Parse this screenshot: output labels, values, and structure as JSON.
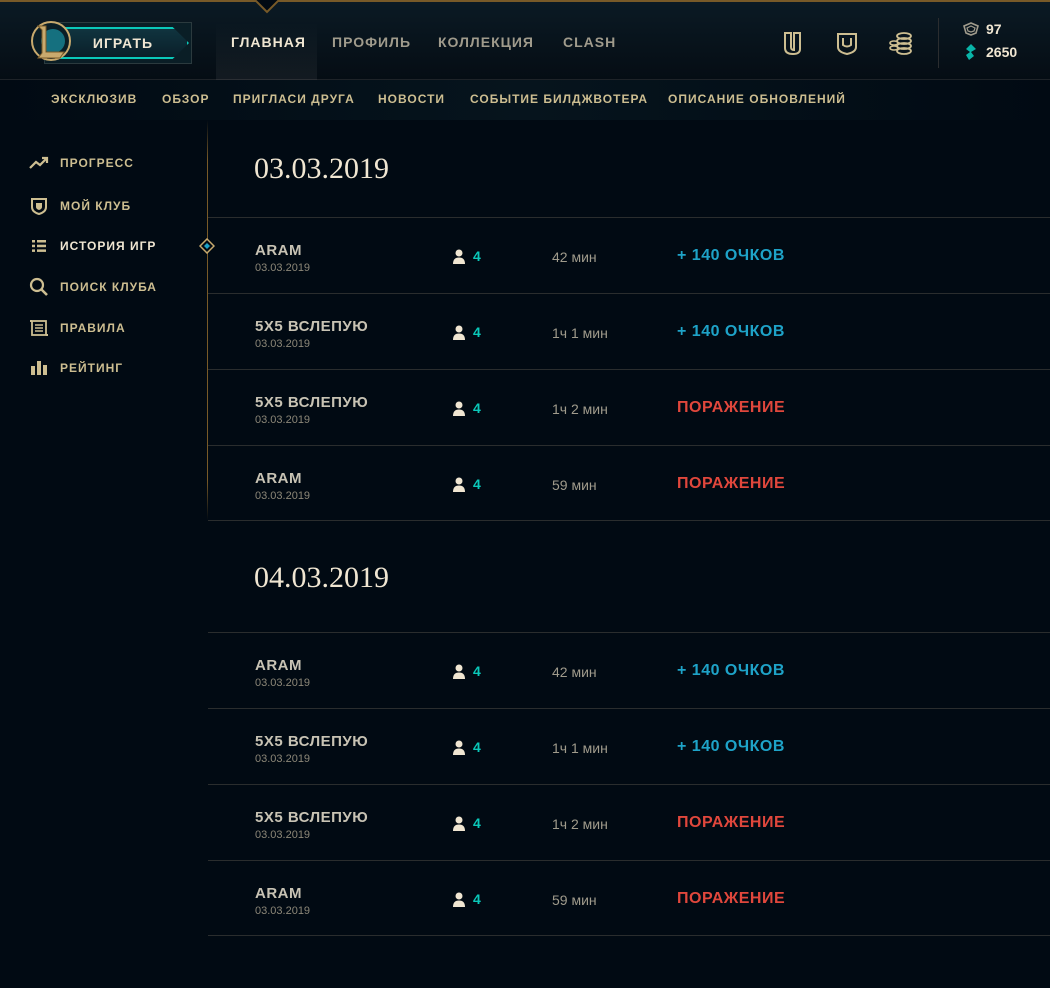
{
  "header": {
    "play_label": "ИГРАТЬ",
    "tabs": [
      "ГЛАВНАЯ",
      "ПРОФИЛЬ",
      "КОЛЛЕКЦИЯ",
      "CLASH"
    ],
    "active_tab": "ГЛАВНАЯ",
    "icons": [
      "honor-shield-icon",
      "loot-chest-icon",
      "store-coins-icon"
    ],
    "currency": {
      "orange_essence": "97",
      "blue_essence": "2650"
    }
  },
  "subnav": {
    "items": [
      "ЭКСКЛЮЗИВ",
      "ОБЗОР",
      "ПРИГЛАСИ ДРУГА",
      "НОВОСТИ",
      "СОБЫТИЕ БИЛДЖВОТЕРА",
      "ОПИСАНИЕ ОБНОВЛЕНИЙ"
    ]
  },
  "sidebar": {
    "items": [
      {
        "label": "ПРОГРЕСС",
        "icon": "trend-up-icon"
      },
      {
        "label": "МОЙ КЛУБ",
        "icon": "club-shield-icon"
      },
      {
        "label": "ИСТОРИЯ ИГР",
        "icon": "list-icon",
        "active": true
      },
      {
        "label": "ПОИСК КЛУБА",
        "icon": "search-icon"
      },
      {
        "label": "ПРАВИЛА",
        "icon": "rules-scroll-icon"
      },
      {
        "label": "РЕЙТИНГ",
        "icon": "bar-chart-icon"
      }
    ]
  },
  "history": {
    "groups": [
      {
        "date": "03.03.2019",
        "games": [
          {
            "mode": "ARAM",
            "date": "03.03.2019",
            "players": "4",
            "duration": "42 мин",
            "result": "+ 140 ОЧКОВ",
            "outcome": "win"
          },
          {
            "mode": "5X5 ВСЛЕПУЮ",
            "date": "03.03.2019",
            "players": "4",
            "duration": "1ч 1 мин",
            "result": "+ 140 ОЧКОВ",
            "outcome": "win"
          },
          {
            "mode": "5X5 ВСЛЕПУЮ",
            "date": "03.03.2019",
            "players": "4",
            "duration": "1ч 2 мин",
            "result": "ПОРАЖЕНИЕ",
            "outcome": "loss"
          },
          {
            "mode": "ARAM",
            "date": "03.03.2019",
            "players": "4",
            "duration": "59 мин",
            "result": "ПОРАЖЕНИЕ",
            "outcome": "loss"
          }
        ]
      },
      {
        "date": "04.03.2019",
        "games": [
          {
            "mode": "ARAM",
            "date": "03.03.2019",
            "players": "4",
            "duration": "42 мин",
            "result": "+ 140 ОЧКОВ",
            "outcome": "win"
          },
          {
            "mode": "5X5 ВСЛЕПУЮ",
            "date": "03.03.2019",
            "players": "4",
            "duration": "1ч 1 мин",
            "result": "+ 140 ОЧКОВ",
            "outcome": "win"
          },
          {
            "mode": "5X5 ВСЛЕПУЮ",
            "date": "03.03.2019",
            "players": "4",
            "duration": "1ч 2 мин",
            "result": "ПОРАЖЕНИЕ",
            "outcome": "loss"
          },
          {
            "mode": "ARAM",
            "date": "03.03.2019",
            "players": "4",
            "duration": "59 мин",
            "result": "ПОРАЖЕНИЕ",
            "outcome": "loss"
          }
        ]
      }
    ]
  },
  "colors": {
    "gold": "#cdbe91",
    "gold_dark": "#785a28",
    "win": "#1ea3c8",
    "loss": "#e0473c",
    "players": "#0ac8b9",
    "background": "#010a13"
  }
}
